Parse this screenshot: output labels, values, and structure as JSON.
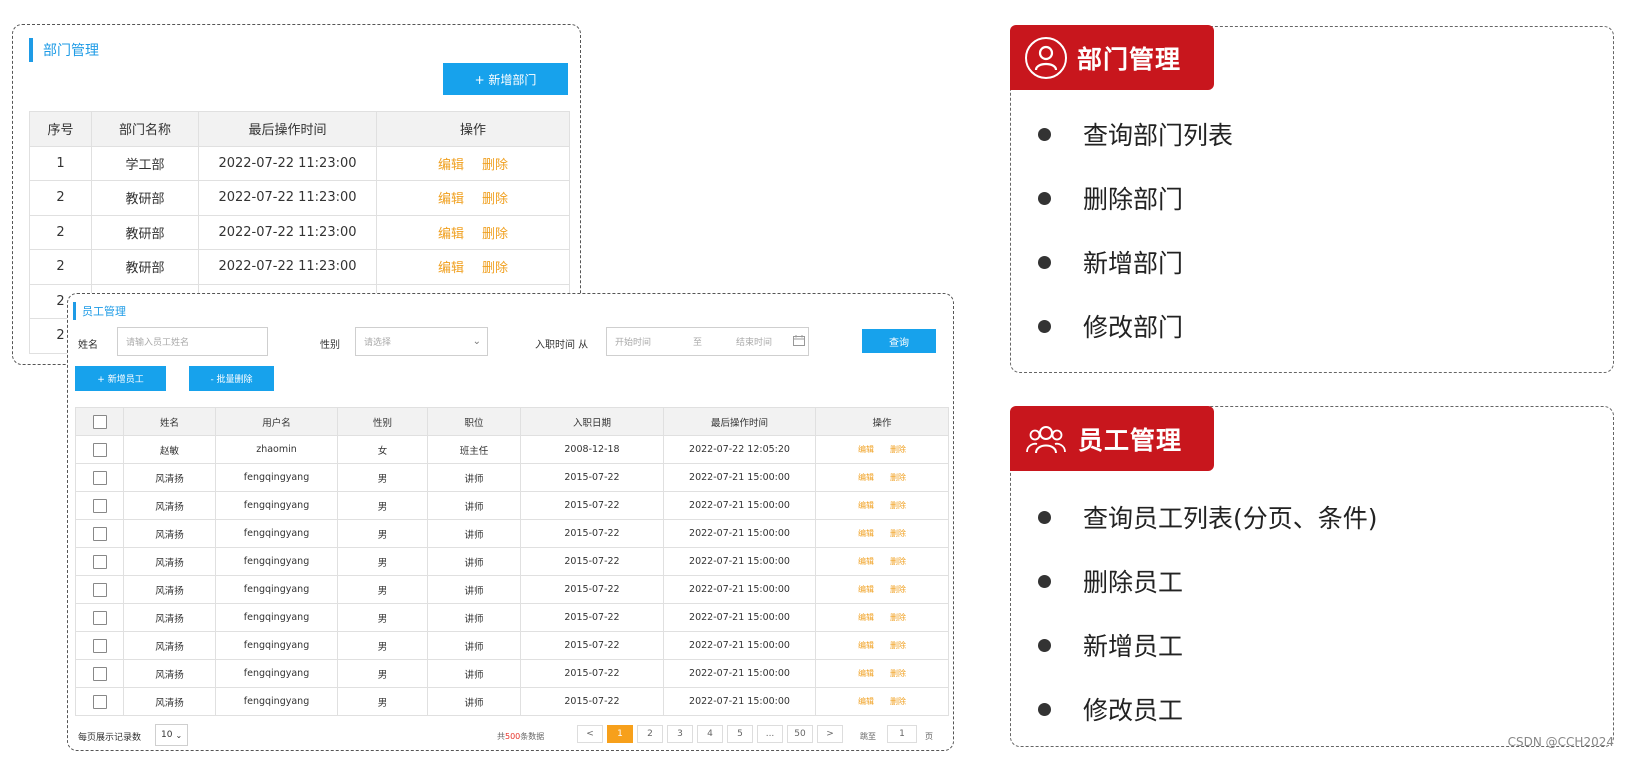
{
  "dept": {
    "title": "部门管理",
    "add_button": "+ 新增部门",
    "columns": [
      "序号",
      "部门名称",
      "最后操作时间",
      "操作"
    ],
    "rows": [
      {
        "no": "1",
        "name": "学工部",
        "time": "2022-07-22 11:23:00"
      },
      {
        "no": "2",
        "name": "教研部",
        "time": "2022-07-22 11:23:00"
      },
      {
        "no": "2",
        "name": "教研部",
        "time": "2022-07-22 11:23:00"
      },
      {
        "no": "2",
        "name": "教研部",
        "time": "2022-07-22 11:23:00"
      },
      {
        "no": "2",
        "name": "",
        "time": ""
      },
      {
        "no": "2",
        "name": "",
        "time": ""
      }
    ],
    "edit_label": "编辑",
    "delete_label": "删除"
  },
  "emp": {
    "title": "员工管理",
    "name_label": "姓名",
    "name_placeholder": "请输入员工姓名",
    "gender_label": "性别",
    "gender_placeholder": "请选择",
    "date_label": "入职时间  从",
    "date_start": "开始时间",
    "date_sep": "至",
    "date_end": "结束时间",
    "search_button": "查询",
    "add_button": "+ 新增员工",
    "batch_delete_button": "- 批量删除",
    "columns": [
      "姓名",
      "用户名",
      "性别",
      "职位",
      "入职日期",
      "最后操作时间",
      "操作"
    ],
    "rows": [
      {
        "name": "赵敏",
        "username": "zhaomin",
        "gender": "女",
        "job": "班主任",
        "entry": "2008-12-18",
        "time": "2022-07-22 12:05:20"
      },
      {
        "name": "风清扬",
        "username": "fengqingyang",
        "gender": "男",
        "job": "讲师",
        "entry": "2015-07-22",
        "time": "2022-07-21 15:00:00"
      },
      {
        "name": "风清扬",
        "username": "fengqingyang",
        "gender": "男",
        "job": "讲师",
        "entry": "2015-07-22",
        "time": "2022-07-21 15:00:00"
      },
      {
        "name": "风清扬",
        "username": "fengqingyang",
        "gender": "男",
        "job": "讲师",
        "entry": "2015-07-22",
        "time": "2022-07-21 15:00:00"
      },
      {
        "name": "风清扬",
        "username": "fengqingyang",
        "gender": "男",
        "job": "讲师",
        "entry": "2015-07-22",
        "time": "2022-07-21 15:00:00"
      },
      {
        "name": "风清扬",
        "username": "fengqingyang",
        "gender": "男",
        "job": "讲师",
        "entry": "2015-07-22",
        "time": "2022-07-21 15:00:00"
      },
      {
        "name": "风清扬",
        "username": "fengqingyang",
        "gender": "男",
        "job": "讲师",
        "entry": "2015-07-22",
        "time": "2022-07-21 15:00:00"
      },
      {
        "name": "风清扬",
        "username": "fengqingyang",
        "gender": "男",
        "job": "讲师",
        "entry": "2015-07-22",
        "time": "2022-07-21 15:00:00"
      },
      {
        "name": "风清扬",
        "username": "fengqingyang",
        "gender": "男",
        "job": "讲师",
        "entry": "2015-07-22",
        "time": "2022-07-21 15:00:00"
      },
      {
        "name": "风清扬",
        "username": "fengqingyang",
        "gender": "男",
        "job": "讲师",
        "entry": "2015-07-22",
        "time": "2022-07-21 15:00:00"
      }
    ],
    "edit_label": "编辑",
    "delete_label": "删除",
    "page_size_label": "每页展示记录数",
    "page_size_value": "10",
    "total_prefix": "共",
    "total_count": "500",
    "total_suffix": "条数据",
    "pages": [
      "<",
      "1",
      "2",
      "3",
      "4",
      "5",
      "...",
      "50",
      ">"
    ],
    "current_page": "1",
    "jump_label": "跳至",
    "jump_value": "1",
    "jump_suffix": "页"
  },
  "right": {
    "dept_card": {
      "title": "部门管理",
      "items": [
        "查询部门列表",
        "删除部门",
        "新增部门",
        "修改部门"
      ]
    },
    "emp_card": {
      "title": "员工管理",
      "items": [
        "查询员工列表(分页、条件)",
        "删除员工",
        "新增员工",
        "修改员工"
      ]
    }
  },
  "colors": {
    "accent_blue": "#17a2ec",
    "badge_red": "#c8161d",
    "action_orange": "#f0a020"
  },
  "watermark": "CSDN @CCH2024"
}
